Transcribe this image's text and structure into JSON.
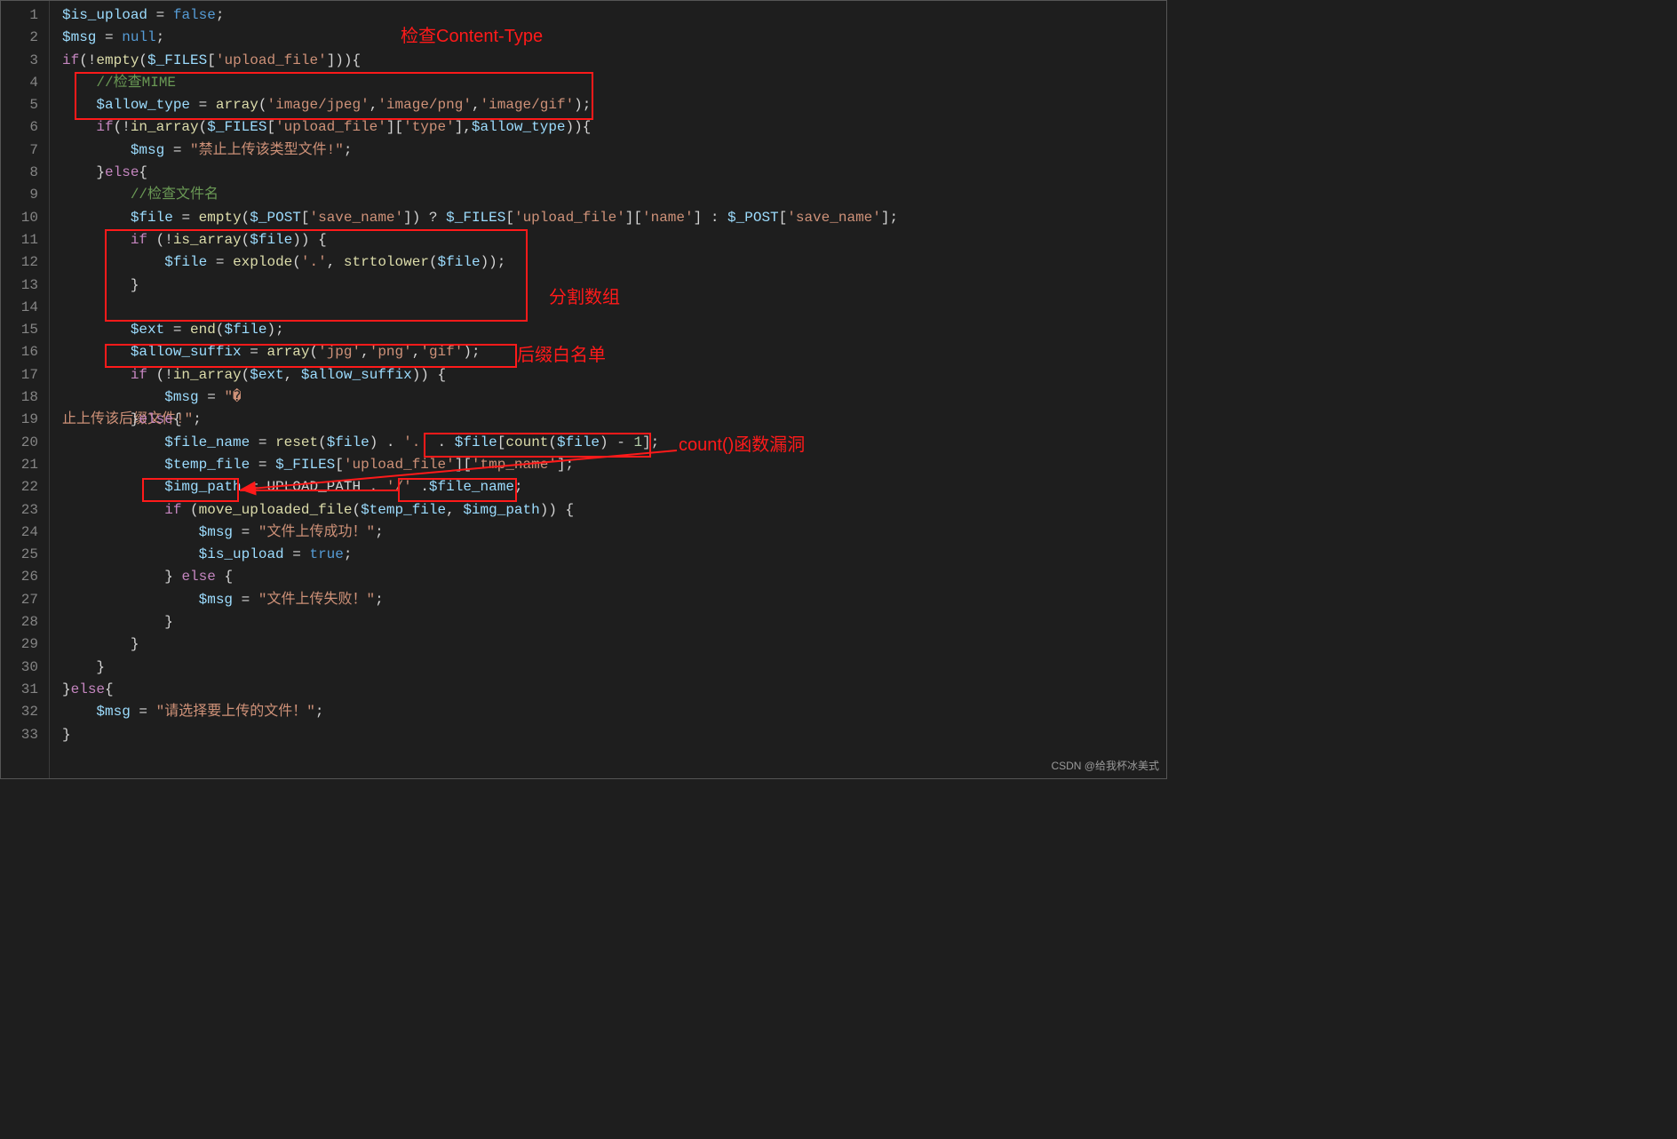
{
  "watermark": "CSDN @给我杯冰美式",
  "lineNumbers": [
    "1",
    "2",
    "3",
    "4",
    "5",
    "6",
    "7",
    "8",
    "9",
    "10",
    "11",
    "12",
    "13",
    "14",
    "15",
    "16",
    "17",
    "18",
    "19",
    "20",
    "21",
    "22",
    "23",
    "24",
    "25",
    "26",
    "27",
    "28",
    "29",
    "30",
    "31",
    "32",
    "33"
  ],
  "annotations": {
    "label_content_type": "检查Content-Type",
    "label_split_array": "分割数组",
    "label_suffix_allow": "后缀白名单",
    "label_count_hole": "count()函数漏洞"
  },
  "code_php_source": "$is_upload = false;\n$msg = null;\nif(!empty($_FILES['upload_file'])){\n    //检查MIME\n    $allow_type = array('image/jpeg','image/png','image/gif');\n    if(!in_array($_FILES['upload_file']['type'],$allow_type)){\n        $msg = \"禁止上传该类型文件!\";\n    }else{\n        //检查文件名\n        $file = empty($_POST['save_name']) ? $_FILES['upload_file']['name'] : $_POST['save_name'];\n        if (!is_array($file)) {\n            $file = explode('.', strtolower($file));\n        }\n\n        $ext = end($file);\n        $allow_suffix = array('jpg','png','gif');\n        if (!in_array($ext, $allow_suffix)) {\n            $msg = \"禁止上传该后缀文件!\";\n        }else{\n            $file_name = reset($file) . '.' . $file[count($file) - 1];\n            $temp_file = $_FILES['upload_file']['tmp_name'];\n            $img_path = UPLOAD_PATH . '/' .$file_name;\n            if (move_uploaded_file($temp_file, $img_path)) {\n                $msg = \"文件上传成功！\";\n                $is_upload = true;\n            } else {\n                $msg = \"文件上传失败！\";\n            }\n        }\n    }\n}else{\n    $msg = \"请选择要上传的文件！\";\n}"
}
